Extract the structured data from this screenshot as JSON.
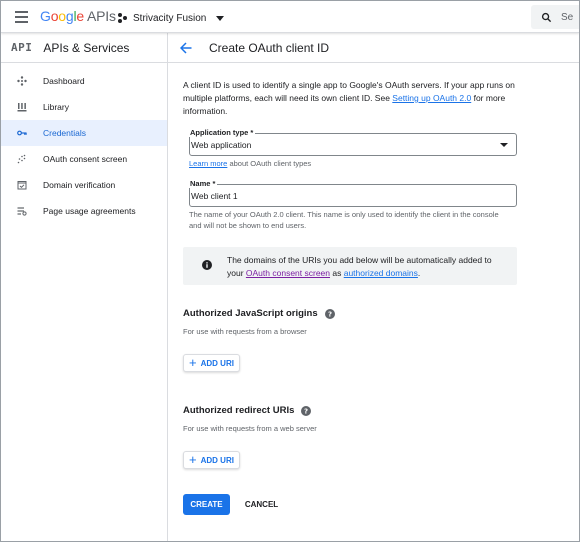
{
  "topbar": {
    "logo_google": [
      "G",
      "o",
      "o",
      "g",
      "l",
      "e"
    ],
    "logo_apis": "APIs",
    "project_name": "Strivacity Fusion",
    "search_placeholder": "Se"
  },
  "sidebar": {
    "badge": "API",
    "title": "APIs & Services",
    "items": [
      {
        "label": "Dashboard",
        "icon": "dashboard-icon"
      },
      {
        "label": "Library",
        "icon": "library-icon"
      },
      {
        "label": "Credentials",
        "icon": "key-icon",
        "active": true
      },
      {
        "label": "OAuth consent screen",
        "icon": "consent-icon"
      },
      {
        "label": "Domain verification",
        "icon": "domain-check-icon"
      },
      {
        "label": "Page usage agreements",
        "icon": "agreements-icon"
      }
    ]
  },
  "content": {
    "title": "Create OAuth client ID",
    "intro_text": "A client ID is used to identify a single app to Google's OAuth servers. If your app runs on multiple platforms, each will need its own client ID. See ",
    "intro_link": "Setting up OAuth 2.0",
    "intro_suffix": " for more information.",
    "app_type_label": "Application type *",
    "app_type_value": "Web application",
    "learn_more_link": "Learn more",
    "learn_more_suffix": " about OAuth client types",
    "name_label": "Name *",
    "name_value": "Web client 1",
    "name_helper": "The name of your OAuth 2.0 client. This name is only used to identify the client in the console and will not be shown to end users.",
    "info_text_1": "The domains of the URIs you add below will be automatically added to your ",
    "info_link_1": "OAuth consent screen",
    "info_text_2": " as ",
    "info_link_2": "authorized domains",
    "info_text_3": ".",
    "js_origins_title": "Authorized JavaScript origins",
    "js_origins_sub": "For use with requests from a browser",
    "redirect_title": "Authorized redirect URIs",
    "redirect_sub": "For use with requests from a web server",
    "add_uri_label": "ADD URI",
    "create_label": "CREATE",
    "cancel_label": "CANCEL"
  },
  "colors": {
    "accent": "#1a73e8",
    "active_bg": "#e8f0fe",
    "info_bg": "#f1f3f4",
    "visited_link": "#7b1fa2"
  }
}
